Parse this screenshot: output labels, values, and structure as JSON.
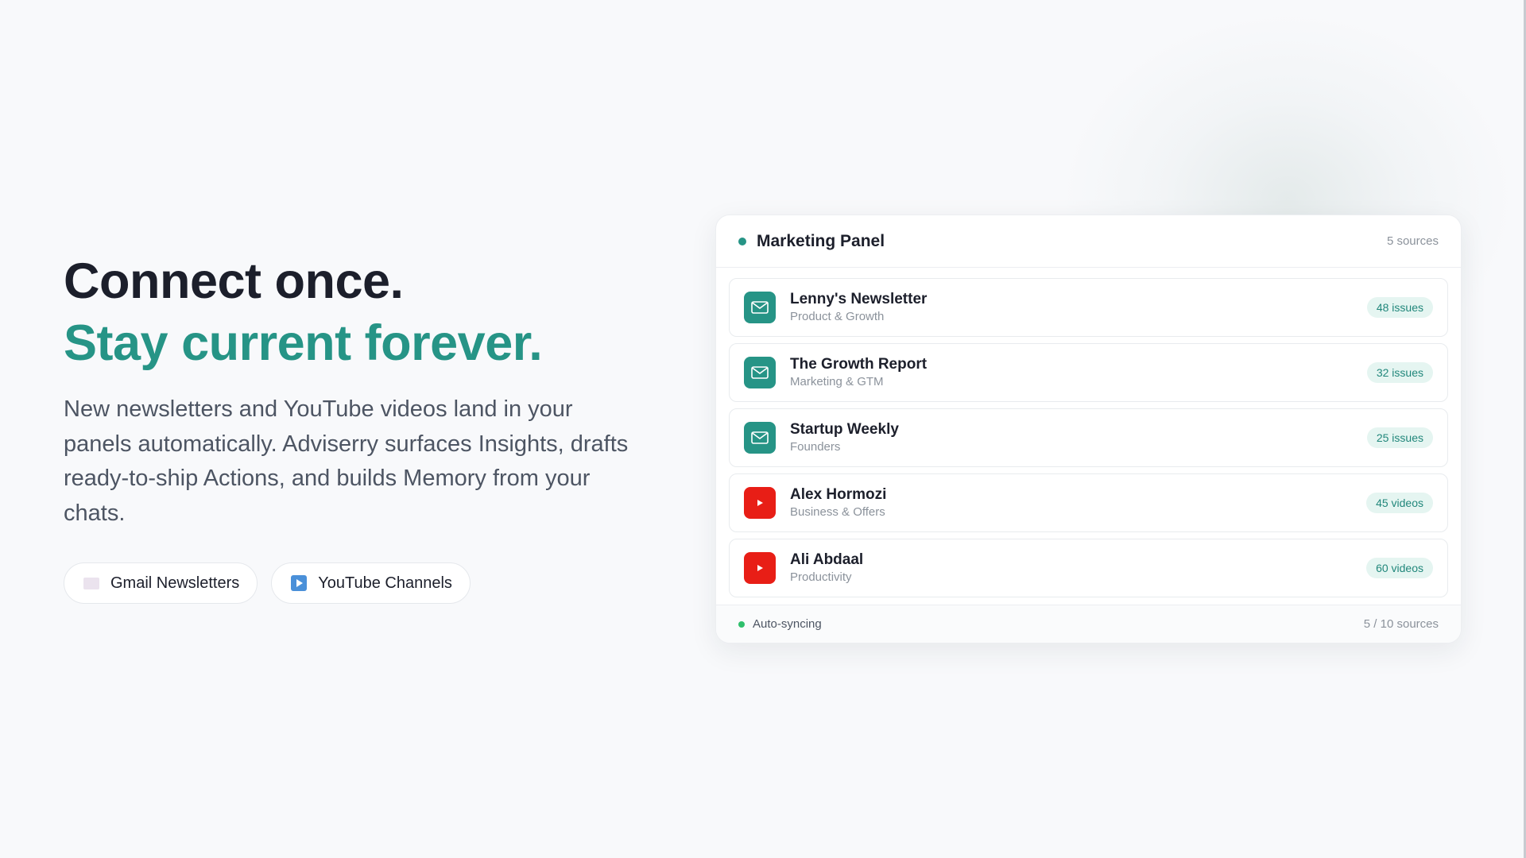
{
  "hero": {
    "headline_1": "Connect once.",
    "headline_2": "Stay current forever.",
    "description": "New newsletters and YouTube videos land in your panels automatically. Adviserry surfaces Insights, drafts ready-to-ship Actions, and builds Memory from your chats.",
    "chips": [
      {
        "label": "Gmail Newsletters",
        "icon": "gmail-icon"
      },
      {
        "label": "YouTube Channels",
        "icon": "youtube-icon"
      }
    ]
  },
  "panel": {
    "title": "Marketing Panel",
    "source_count": "5 sources",
    "sources": [
      {
        "name": "Lenny's Newsletter",
        "category": "Product & Growth",
        "badge": "48 issues",
        "icon": "mail-icon"
      },
      {
        "name": "The Growth Report",
        "category": "Marketing & GTM",
        "badge": "32 issues",
        "icon": "mail-icon"
      },
      {
        "name": "Startup Weekly",
        "category": "Founders",
        "badge": "25 issues",
        "icon": "mail-icon"
      },
      {
        "name": "Alex Hormozi",
        "category": "Business & Offers",
        "badge": "45 videos",
        "icon": "play-icon"
      },
      {
        "name": "Ali Abdaal",
        "category": "Productivity",
        "badge": "60 videos",
        "icon": "play-icon"
      }
    ],
    "footer": {
      "status": "Auto-syncing",
      "usage": "5 / 10 sources"
    }
  },
  "colors": {
    "accent": "#269486",
    "youtube_red": "#e81e16",
    "badge_bg": "#e5f5f1",
    "sync_green": "#2fbf6c",
    "text_dark": "#1c1f2b"
  }
}
